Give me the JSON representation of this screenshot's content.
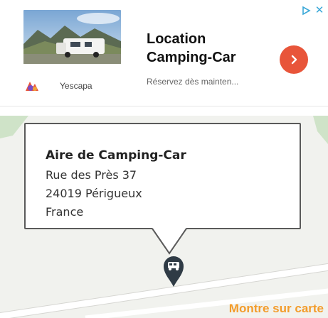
{
  "ad": {
    "title": "Location Camping-Car",
    "subtitle": "Réservez dès mainten...",
    "brand": "Yescapa",
    "close_glyph": "✕",
    "cta_icon": "chevron-right-icon",
    "colors": {
      "cta": "#e8553a",
      "choices": "#3aa8d8"
    }
  },
  "map": {
    "popup": {
      "name": "Aire de Camping-Car",
      "street": "Rue des Près 37",
      "city": "24019 Périgueux",
      "country": "France"
    },
    "marker_icon": "camper-van-icon",
    "show_on_map_label": "Montre sur carte",
    "colors": {
      "link": "#f39c2b",
      "marker": "#2f3b45"
    }
  }
}
